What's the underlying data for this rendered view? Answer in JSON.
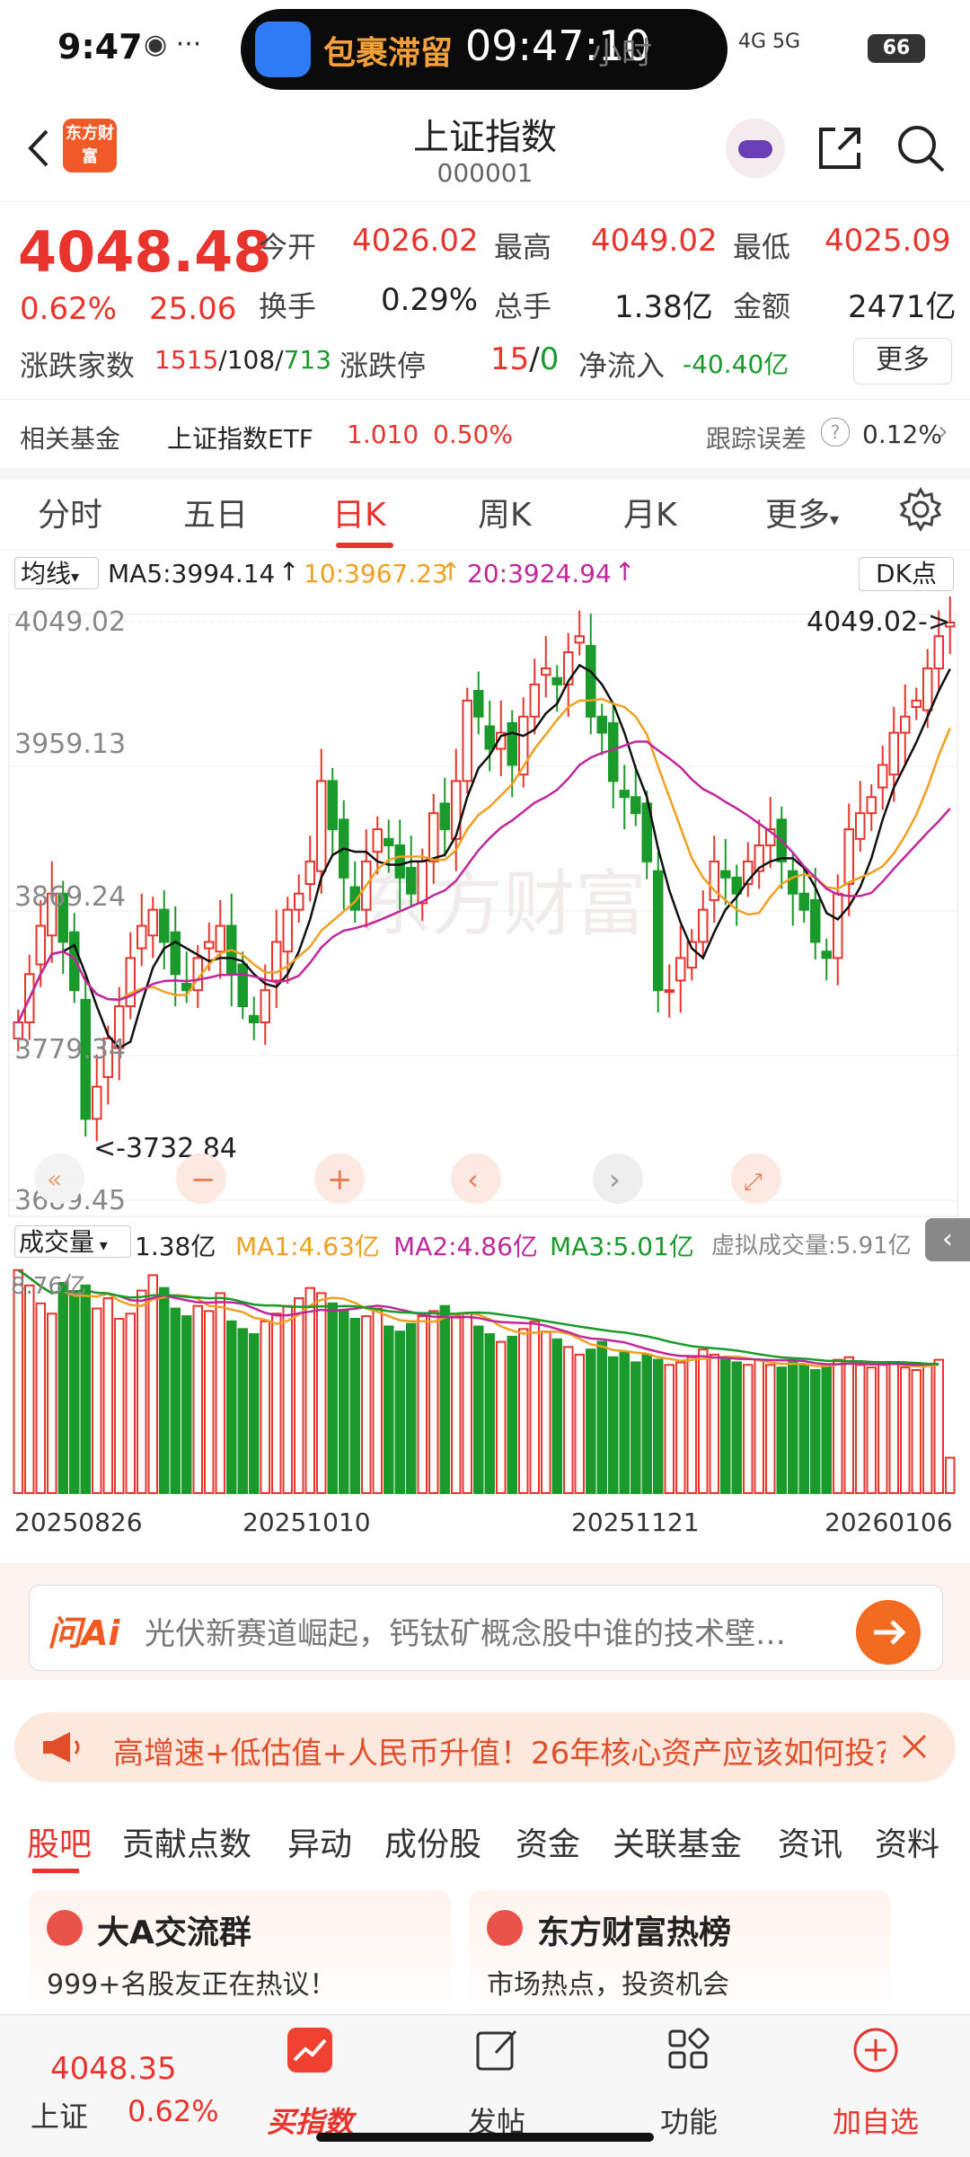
{
  "status_bar": {
    "time": "9:47",
    "island_text": "包裹滞留",
    "island_time": "09:47:10",
    "island_sub": "小时",
    "network": "4G 5G",
    "battery": "66"
  },
  "header": {
    "title": "上证指数",
    "code": "000001",
    "logo_text": "东方财富"
  },
  "quote": {
    "price": "4048.48",
    "pct": "0.62%",
    "change": "25.06",
    "open_label": "今开",
    "open": "4026.02",
    "high_label": "最高",
    "high": "4049.02",
    "low_label": "最低",
    "low": "4025.09",
    "turnover_label": "换手",
    "turnover": "0.29%",
    "volume_label": "总手",
    "volume": "1.38亿",
    "amount_label": "金额",
    "amount": "2471亿",
    "adv_label": "涨跌家数",
    "adv_up": "1515",
    "adv_flat": "108",
    "adv_down": "713",
    "limit_label": "涨跌停",
    "limit_up": "15",
    "limit_down": "0",
    "inflow_label": "净流入",
    "inflow": "-40.40亿",
    "more": "更多"
  },
  "fund": {
    "label": "相关基金",
    "name": "上证指数ETF",
    "price": "1.010",
    "pct": "0.50%",
    "err_label": "跟踪误差",
    "err": "0.12%"
  },
  "chart_tabs": [
    "分时",
    "五日",
    "日K",
    "周K",
    "月K",
    "更多"
  ],
  "ma_row": {
    "select": "均线",
    "ma5": "MA5:3994.14",
    "ma10": "10:3967.23",
    "ma20": "20:3924.94",
    "dk": "DK点"
  },
  "chart_labels": {
    "y1": "4049.02",
    "y2": "3959.13",
    "y3": "3869.24",
    "y4": "3779.34",
    "y5": "3689.45",
    "max_note": "4049.02->",
    "min_note": "<-3732.84"
  },
  "vol_row": {
    "select": "成交量",
    "vol": "1.38亿",
    "ma1": "MA1:4.63亿",
    "ma2": "MA2:4.86亿",
    "ma3": "MA3:5.01亿",
    "virtual": "虚拟成交量:5.91亿",
    "max": "8.76亿"
  },
  "dates": [
    "20250826",
    "20251010",
    "20251121",
    "20260106"
  ],
  "ai": {
    "logo": "问Ai",
    "text": "光伏新赛道崛起，钙钛矿概念股中谁的技术壁…"
  },
  "banner": {
    "text": "高增速+低估值+人民币升值！26年核心资产应该如何投?"
  },
  "section_tabs": [
    "股吧",
    "贡献点数",
    "异动",
    "成份股",
    "资金",
    "关联基金",
    "资讯",
    "资料"
  ],
  "cards": [
    {
      "title": "大A交流群",
      "sub": "999+名股友正在热议！"
    },
    {
      "title": "东方财富热榜",
      "sub": "市场热点，投资机会"
    }
  ],
  "bottom_nav": {
    "price": "4048.35",
    "name": "上证",
    "pct": "0.62%",
    "buy": "买指数",
    "post": "发帖",
    "func": "功能",
    "add": "加自选"
  },
  "colors": {
    "up": "#e8342c",
    "down": "#1a9a2a",
    "ma5": "#111111",
    "ma10": "#f0a020",
    "ma20": "#c0279a"
  },
  "chart_data": {
    "type": "candlestick",
    "y_range": [
      3689.45,
      4049.02
    ],
    "y_ticks": [
      4049.02,
      3959.13,
      3869.24,
      3779.34,
      3689.45
    ],
    "x_tick_labels": [
      "20250826",
      "20251010",
      "20251121",
      "20260106"
    ],
    "close": [
      3800,
      3830,
      3860,
      3880,
      3850,
      3820,
      3740,
      3760,
      3790,
      3810,
      3840,
      3860,
      3870,
      3850,
      3830,
      3820,
      3840,
      3850,
      3860,
      3830,
      3810,
      3800,
      3820,
      3850,
      3870,
      3880,
      3900,
      3950,
      3920,
      3890,
      3870,
      3900,
      3920,
      3910,
      3890,
      3880,
      3900,
      3930,
      3920,
      3950,
      4000,
      3990,
      3970,
      3980,
      3960,
      3990,
      4010,
      4020,
      4010,
      4030,
      4040,
      3990,
      3980,
      3950,
      3940,
      3930,
      3900,
      3820,
      3820,
      3840,
      3850,
      3870,
      3900,
      3890,
      3880,
      3900,
      3910,
      3920,
      3900,
      3880,
      3870,
      3850,
      3840,
      3880,
      3920,
      3930,
      3940,
      3960,
      3980,
      3990,
      4000,
      4020,
      4040,
      4048.48
    ],
    "volume_yi": [
      8.7,
      8.1,
      7.4,
      7.0,
      8.2,
      7.8,
      8.1,
      7.2,
      7.6,
      6.8,
      7.0,
      7.9,
      8.5,
      8.0,
      7.2,
      6.9,
      7.3,
      7.1,
      7.8,
      6.7,
      6.4,
      6.2,
      6.7,
      7.0,
      7.3,
      7.6,
      8.0,
      7.8,
      7.4,
      7.1,
      6.8,
      6.9,
      7.2,
      6.5,
      6.3,
      6.6,
      6.9,
      7.1,
      7.3,
      6.9,
      7.0,
      6.5,
      6.2,
      5.9,
      6.1,
      6.4,
      6.7,
      6.3,
      6.0,
      5.7,
      5.4,
      5.6,
      5.9,
      5.3,
      5.5,
      5.1,
      5.4,
      5.2,
      5.0,
      5.1,
      5.3,
      5.6,
      5.4,
      5.2,
      5.1,
      5.0,
      5.2,
      5.0,
      4.9,
      5.1,
      5.0,
      4.8,
      5.0,
      5.2,
      5.3,
      5.0,
      4.9,
      5.0,
      5.1,
      4.9,
      4.8,
      5.0,
      5.2,
      1.38
    ]
  }
}
